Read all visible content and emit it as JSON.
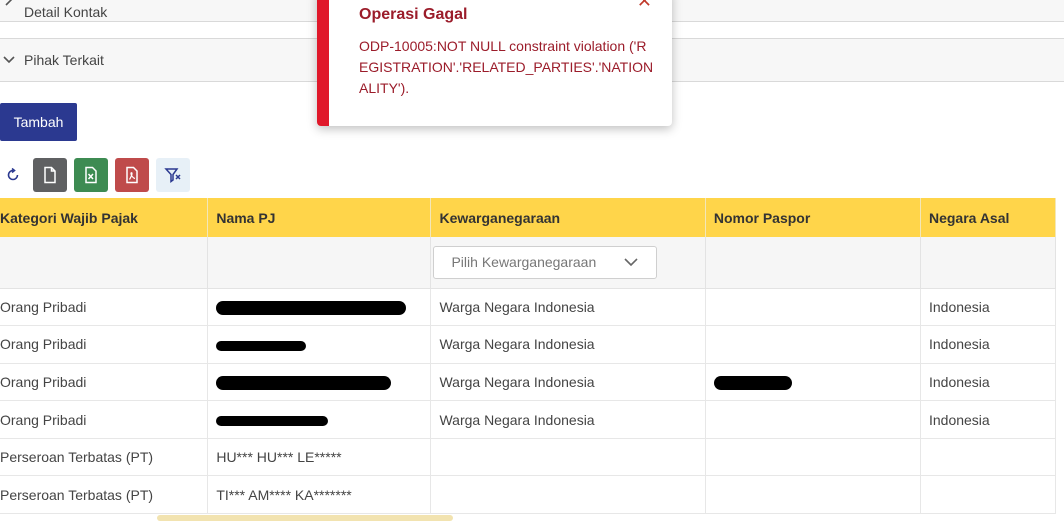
{
  "accordion": {
    "detail_kontak": "Detail Kontak",
    "pihak_terkait": "Pihak Terkait"
  },
  "actions": {
    "tambah_label": "Tambah"
  },
  "toolbar": {
    "icons": [
      "refresh-icon",
      "file-icon",
      "excel-icon",
      "pdf-icon",
      "filter-clear-icon"
    ]
  },
  "table": {
    "columns": [
      "Kategori Wajib Pajak",
      "Nama PJ",
      "Kewarganegaraan",
      "Nomor Paspor",
      "Negara Asal"
    ],
    "filter": {
      "kewarganegaraan_placeholder": "Pilih Kewarganegaraan"
    },
    "rows": [
      {
        "kategori": "Orang Pribadi",
        "nama": "",
        "kewarganegaraan": "Warga Negara Indonesia",
        "paspor": "",
        "negara": "Indonesia"
      },
      {
        "kategori": "Orang Pribadi",
        "nama": "",
        "kewarganegaraan": "Warga Negara Indonesia",
        "paspor": "",
        "negara": "Indonesia"
      },
      {
        "kategori": "Orang Pribadi",
        "nama": "",
        "kewarganegaraan": "Warga Negara Indonesia",
        "paspor": "",
        "negara": "Indonesia"
      },
      {
        "kategori": "Orang Pribadi",
        "nama": "",
        "kewarganegaraan": "Warga Negara Indonesia",
        "paspor": "",
        "negara": "Indonesia"
      },
      {
        "kategori": "Perseroan Terbatas (PT)",
        "nama": "HU*** HU*** LE*****",
        "kewarganegaraan": "",
        "paspor": "",
        "negara": ""
      },
      {
        "kategori": "Perseroan Terbatas (PT)",
        "nama": "TI*** AM**** KA*******",
        "kewarganegaraan": "",
        "paspor": "",
        "negara": ""
      }
    ]
  },
  "toast": {
    "title": "Operasi Gagal",
    "message": "ODP-10005:NOT NULL constraint violation ('REGISTRATION'.'RELATED_PARTIES'.'NATIONALITY').",
    "accent_color": "#e0182a"
  },
  "colors": {
    "primary_button": "#2b3990",
    "table_header": "#ffd54a"
  }
}
